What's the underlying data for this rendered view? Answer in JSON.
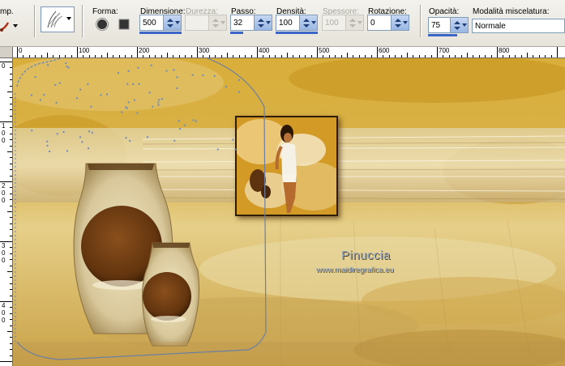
{
  "toolbar": {
    "partial_label": "mp.",
    "forma": {
      "label": "Forma:"
    },
    "dimensione": {
      "label": "Dimensione:",
      "value": "500"
    },
    "durezza": {
      "label": "Durezza:",
      "value": ""
    },
    "passo": {
      "label": "Passo:",
      "value": "32"
    },
    "densita": {
      "label": "Densità:",
      "value": "100"
    },
    "spessore": {
      "label": "Spessore:",
      "value": "100"
    },
    "rotazione": {
      "label": "Rotazione:",
      "value": "0"
    },
    "opacita": {
      "label": "Opacità:",
      "value": "75"
    },
    "modalita": {
      "label": "Modalità miscelatura:",
      "value": "Normale"
    }
  },
  "ruler": {
    "h_labels": [
      "0",
      "100",
      "200",
      "300",
      "400",
      "500",
      "600",
      "700",
      "800"
    ],
    "v_labels": [
      "0",
      "100",
      "200",
      "300",
      "400"
    ]
  },
  "canvas": {
    "watermark": "Pinuccia",
    "watermark_url": "www.maidiregrafica.eu",
    "colors": {
      "gold": "#c99b23",
      "cream": "#efe2b4",
      "brown": "#6a3b12",
      "selection": "#5b86c8"
    }
  }
}
